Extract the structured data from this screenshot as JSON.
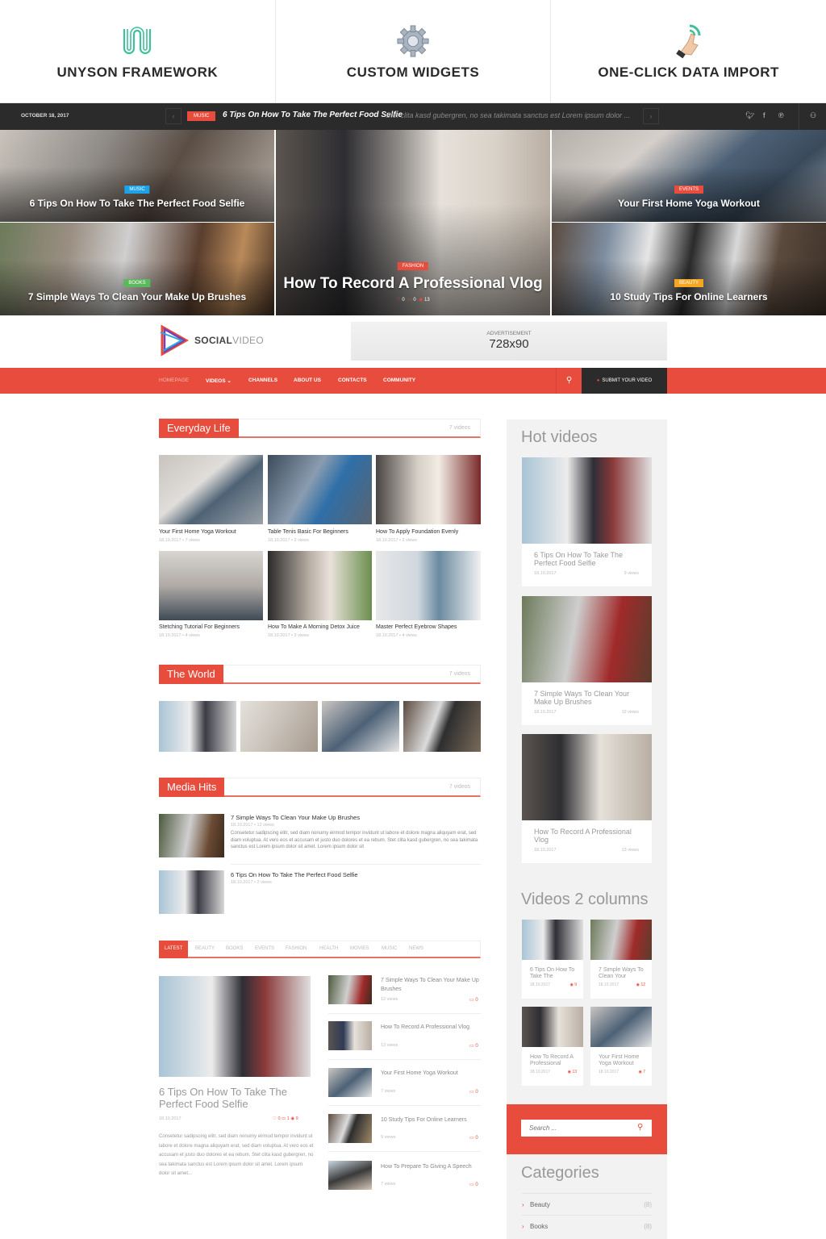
{
  "features": [
    {
      "icon": "unyson-logo-icon",
      "label": "UNYSON FRAMEWORK"
    },
    {
      "icon": "gear-icon",
      "label": "CUSTOM WIDGETS"
    },
    {
      "icon": "hand-click-icon",
      "label": "ONE-CLICK DATA IMPORT"
    }
  ],
  "ticker": {
    "date": "OCTOBER 18, 2017",
    "prev": "‹",
    "next": "›",
    "category": "MUSIC",
    "title": "6 Tips On How To Take The Perfect Food Selfie",
    "excerpt": "Stet clita kasd gubergren, no sea takimata sanctus est Lorem ipsum dolor ...",
    "social": [
      "twitter-icon",
      "facebook-icon",
      "pinterest-icon"
    ],
    "user_icon": "user-icon"
  },
  "hero": [
    {
      "category": "MUSIC",
      "category_color": "#1da1e8",
      "title": "6 Tips On How To Take The Perfect Food Selfie"
    },
    {
      "category": "BOOKS",
      "category_color": "#5cb85c",
      "title": "7 Simple Ways To Clean Your Make Up Brushes"
    },
    {
      "category": "FASHION",
      "category_color": "#e74c3c",
      "title": "How To Record A Professional Vlog",
      "likes": "0",
      "comments": "0",
      "views": "13"
    },
    {
      "category": "EVENTS",
      "category_color": "#e74c3c",
      "title": "Your First Home Yoga Workout"
    },
    {
      "category": "BEAUTY",
      "category_color": "#f5a623",
      "title": "10 Study Tips For Online Learners"
    }
  ],
  "header": {
    "logo_bold": "SOCIAL",
    "logo_light": "VIDEO",
    "ad_label": "ADVERTISEMENT",
    "ad_size": "728x90"
  },
  "nav": {
    "items": [
      "HOMEPAGE",
      "VIDEOS",
      "CHANNELS",
      "ABOUT US",
      "CONTACTS",
      "COMMUNITY"
    ],
    "videos_chevron": "⌄",
    "search_icon": "⚲",
    "submit": "SUBMIT YOUR VIDEO"
  },
  "sections": {
    "everyday": {
      "title": "Everyday Life",
      "count": "7 videos",
      "items": [
        {
          "title": "Your First Home Yoga Workout",
          "meta": "18.10.2017 • 7 views"
        },
        {
          "title": "Table Tenis Basic For Beginners",
          "meta": "18.10.2017 • 2 views"
        },
        {
          "title": "How To Apply Foundation Evenly",
          "meta": "18.10.2017 • 2 views"
        },
        {
          "title": "Stetching Tutorial For Beginners",
          "meta": "18.10.2017 • 4 views"
        },
        {
          "title": "How To Make A Morning Detox Juice",
          "meta": "18.10.2017 • 3 views"
        },
        {
          "title": "Master Perfect Eyebrow Shapes",
          "meta": "18.10.2017 • 4 views"
        }
      ]
    },
    "world": {
      "title": "The World",
      "count": "7 videos"
    },
    "mediahits": {
      "title": "Media Hits",
      "count": "7 videos",
      "items": [
        {
          "title": "7 Simple Ways To Clean Your Make Up Brushes",
          "meta": "18.10.2017 • 12 views",
          "excerpt": "Consetetur sadipscing elitr, sed diam nonumy eirmod tempor invidunt ut labore et dolore magna aliquyam erat, sed diam voluptua. At vero eos et accusam et justo duo dolores et ea rebum. Stet clita kasd gubergren, no sea takimata sanctus est Lorem ipsum dolor sit amet. Lorem ipsum dolor sit"
        },
        {
          "title": "6 Tips On How To Take The Perfect Food Selfie",
          "meta": "18.10.2017 • 2 views"
        }
      ]
    }
  },
  "tabs": [
    "LATEST",
    "BEAUTY",
    "BOOKS",
    "EVENTS",
    "FASHION",
    "HEALTH",
    "MOVIES",
    "MUSIC",
    "NEWS"
  ],
  "latest": {
    "featured": {
      "title": "6 Tips On How To Take The Perfect Food Selfie",
      "date": "18.10.2017",
      "stats": "♡ 0  ▭ 1  ◉ 9",
      "excerpt": "Consetetur sadipscing elitr, sed diam nonumy eirmod tempor invidunt ut labore et dolore magna aliquyam erat, sed diam voluptua. At vero eos et accusam et justo duo dolores et ea rebum. Stet clita kasd gubergren, no sea takimata sanctus est Lorem ipsum dolor sit amet. Lorem ipsum dolor sit amet..."
    },
    "list": [
      {
        "title": "7 Simple Ways To Clean Your Make Up Brushes",
        "views": "12 views",
        "comments": "0"
      },
      {
        "title": "How To Record A Professional Vlog",
        "views": "13 views",
        "comments": "0"
      },
      {
        "title": "Your First Home Yoga Workout",
        "views": "7 views",
        "comments": "0"
      },
      {
        "title": "10 Study Tips For Online Learners",
        "views": "9 views",
        "comments": "0"
      },
      {
        "title": "How To Prepare To Giving A Speech",
        "views": "7 views",
        "comments": "0"
      }
    ]
  },
  "sidebar": {
    "hot_title": "Hot videos",
    "hot": [
      {
        "title": "6 Tips On How To Take The Perfect Food Selfie",
        "date": "18.10.2017",
        "views": "9 views"
      },
      {
        "title": "7 Simple Ways To Clean Your Make Up Brushes",
        "date": "18.10.2017",
        "views": "12 views"
      },
      {
        "title": "How To Record A Professional Vlog",
        "date": "18.10.2017",
        "views": "13 views"
      }
    ],
    "two_col_title": "Videos 2 columns",
    "two_col": [
      {
        "title": "6 Tips On How To Take The",
        "date": "18.10.2017",
        "views": "9"
      },
      {
        "title": "7 Simple Ways To Clean Your",
        "date": "18.10.2017",
        "views": "12"
      },
      {
        "title": "How To Record A Professional",
        "date": "18.10.2017",
        "views": "13"
      },
      {
        "title": "Your First Home Yoga Workout",
        "date": "18.10.2017",
        "views": "7"
      }
    ],
    "search_placeholder": "Search ...",
    "categories_title": "Categories",
    "categories": [
      {
        "name": "Beauty",
        "count": "(8)"
      },
      {
        "name": "Books",
        "count": "(8)"
      }
    ]
  },
  "colors": {
    "accent": "#e74c3c",
    "dark": "#2b2b2b",
    "sidebar_bg": "#f2f2f2"
  }
}
